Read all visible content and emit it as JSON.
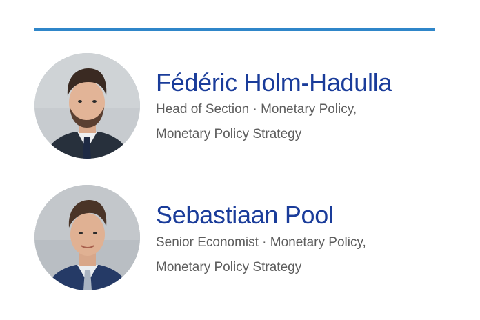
{
  "people": [
    {
      "name": "Fédéric Holm-Hadulla",
      "role_line1": "Head of Section · Monetary Policy,",
      "role_line2": "Monetary Policy Strategy"
    },
    {
      "name": "Sebastiaan Pool",
      "role_line1": "Senior Economist · Monetary Policy,",
      "role_line2": "Monetary Policy Strategy"
    }
  ],
  "colors": {
    "accent_rule": "#2f86c9",
    "name_link": "#1a3c9a",
    "role_text": "#5d5d5d",
    "divider": "#d4d4d4"
  }
}
